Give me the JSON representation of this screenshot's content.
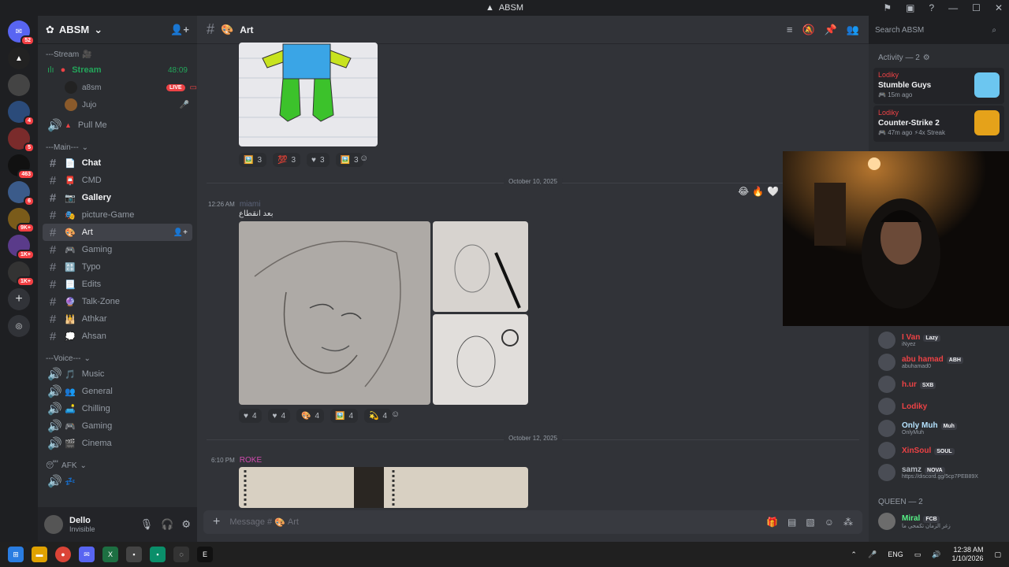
{
  "window": {
    "title": "ABSM"
  },
  "server_badges": [
    "52",
    "4",
    "5",
    "463",
    "6",
    "9K+",
    "1K+",
    "1K+"
  ],
  "guild": {
    "name": "ABSM"
  },
  "sidebar": {
    "stream_category": "---Stream",
    "stream_channel": "Stream",
    "stream_time": "48:09",
    "stream_users": [
      {
        "name": "a8sm",
        "badge": "LIVE"
      },
      {
        "name": "Jujo"
      }
    ],
    "pull_me": "Pull Me",
    "main_category": "---Main---",
    "channels": [
      {
        "label": "Chat",
        "emoji": "📄",
        "bold": true
      },
      {
        "label": "CMD",
        "emoji": "📮"
      },
      {
        "label": "Gallery",
        "emoji": "📷",
        "bold": true
      },
      {
        "label": "picture-Game",
        "emoji": "🎭"
      },
      {
        "label": "Art",
        "emoji": "🎨",
        "active": true
      },
      {
        "label": "Gaming",
        "emoji": "🎮"
      },
      {
        "label": "Typo",
        "emoji": "🔠"
      },
      {
        "label": "Edits",
        "emoji": "📃"
      },
      {
        "label": "Talk-Zone",
        "emoji": "🔮"
      },
      {
        "label": "Athkar",
        "emoji": "🕌"
      },
      {
        "label": "Ahsan",
        "emoji": "💭"
      }
    ],
    "voice_category": "---Voice---",
    "voice_channels": [
      {
        "label": "Music",
        "emoji": "🎵"
      },
      {
        "label": "General",
        "emoji": "👥"
      },
      {
        "label": "Chilling",
        "emoji": "🛋️"
      },
      {
        "label": "Gaming",
        "emoji": "🎮"
      },
      {
        "label": "Cinema",
        "emoji": "🎬"
      }
    ],
    "afk_category": "AFK",
    "afk_emoji": "😴",
    "afk_channel_emoji": "💤"
  },
  "user": {
    "name": "Dello",
    "status": "Invisible"
  },
  "channel_header": {
    "name": "Art",
    "emoji": "🎨"
  },
  "search": {
    "placeholder": "Search ABSM"
  },
  "messages": {
    "reactions_top": [
      {
        "emoji": "🖼️",
        "count": "3"
      },
      {
        "emoji": "💯",
        "count": "3"
      },
      {
        "emoji": "♥",
        "count": "3"
      },
      {
        "emoji": "🖼️",
        "count": "3"
      }
    ],
    "divider_1": "October 10, 2025",
    "msg_1": {
      "time": "12:26 AM",
      "author": "miami",
      "text": "بعد انقطاع"
    },
    "floating_reacts": [
      "😂",
      "🔥",
      "🤍"
    ],
    "reactions_mid": [
      {
        "emoji": "♥",
        "count": "4"
      },
      {
        "emoji": "♥",
        "count": "4"
      },
      {
        "emoji": "🎨",
        "count": "4"
      },
      {
        "emoji": "🖼️",
        "count": "4"
      },
      {
        "emoji": "💫",
        "count": "4"
      }
    ],
    "divider_2": "October 12, 2025",
    "msg_2": {
      "time": "6:10 PM",
      "author": "ROKE"
    }
  },
  "composer": {
    "placeholder": "Message #",
    "channel": "Art",
    "emoji": "🎨"
  },
  "members": {
    "activity_header": "Activity — 2",
    "activities": [
      {
        "user": "Lodiky",
        "game": "Stumble Guys",
        "meta": "15m ago"
      },
      {
        "user": "Lodiky",
        "game": "Counter-Strike 2",
        "meta": "47m ago",
        "streak": "4x Streak"
      }
    ],
    "list": [
      {
        "name": "I Van",
        "tag": "Lazy",
        "sub": "iNyez",
        "color": "#ed4245"
      },
      {
        "name": "abu hamad",
        "tag": "ABH",
        "sub": "abuhamad0",
        "color": "#ed4245"
      },
      {
        "name": "h.ur",
        "tag": "SXB",
        "sub": "",
        "color": "#ed4245"
      },
      {
        "name": "Lodiky",
        "tag": "",
        "sub": "",
        "color": "#ed4245"
      },
      {
        "name": "Only Muh",
        "tag": "Muh",
        "sub": "OnlyMuh",
        "color": "#b5e3ff"
      },
      {
        "name": "XinSoul",
        "tag": "SOUL",
        "sub": "",
        "color": "#ed4245"
      },
      {
        "name": "samz",
        "tag": "NOVA",
        "sub": "https://discord.gg/5cp7PEB89X",
        "color": "#b5bac1"
      }
    ],
    "queen_header": "QUEEN — 2",
    "queen": [
      {
        "name": "Miral",
        "tag": "FCB",
        "sub": "ﺯﻏﺮ ﺍﻟﺰﻣﺎﻥ ﺗﻜﻤﺤﻲ ﻣﺎ",
        "color": "#57f287"
      }
    ]
  },
  "taskbar": {
    "lang": "ENG",
    "time": "12:38 AM",
    "date": "1/10/2026"
  }
}
